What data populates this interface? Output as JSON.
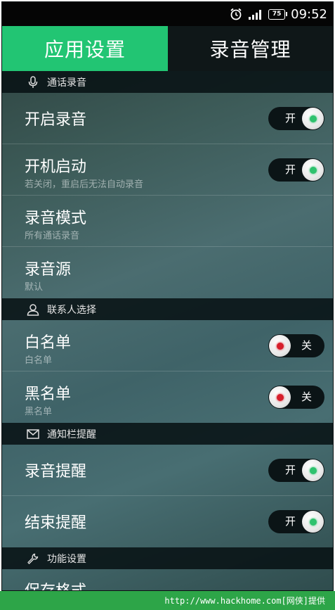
{
  "status_bar": {
    "battery": "75",
    "time": "09:52"
  },
  "tabs": [
    {
      "label": "应用设置",
      "active": true
    },
    {
      "label": "录音管理",
      "active": false
    }
  ],
  "sections": [
    {
      "title": "通话录音",
      "icon": "microphone-icon",
      "items": [
        {
          "title": "开启录音",
          "subtitle": "",
          "toggle": "开",
          "on": true
        },
        {
          "title": "开机启动",
          "subtitle": "若关闭，重启后无法自动录音",
          "toggle": "开",
          "on": true
        },
        {
          "title": "录音模式",
          "subtitle": "所有通话录音"
        },
        {
          "title": "录音源",
          "subtitle": "默认"
        }
      ]
    },
    {
      "title": "联系人选择",
      "icon": "person-icon",
      "items": [
        {
          "title": "白名单",
          "subtitle": "白名单",
          "toggle": "关",
          "on": false
        },
        {
          "title": "黑名单",
          "subtitle": "黑名单",
          "toggle": "关",
          "on": false
        }
      ]
    },
    {
      "title": "通知栏提醒",
      "icon": "envelope-icon",
      "items": [
        {
          "title": "录音提醒",
          "subtitle": "",
          "toggle": "开",
          "on": true
        },
        {
          "title": "结束提醒",
          "subtitle": "",
          "toggle": "开",
          "on": true
        }
      ]
    },
    {
      "title": "功能设置",
      "icon": "wrench-icon",
      "items": [
        {
          "title": "保存格式"
        }
      ]
    }
  ],
  "footer": {
    "text": "http://www.hackhome.com[网侠]提供"
  },
  "colors": {
    "accent": "#22c573",
    "toggle_on_dot": "#2fc26e",
    "toggle_off_dot": "#d61e2b",
    "footer_bg": "#2da548"
  }
}
